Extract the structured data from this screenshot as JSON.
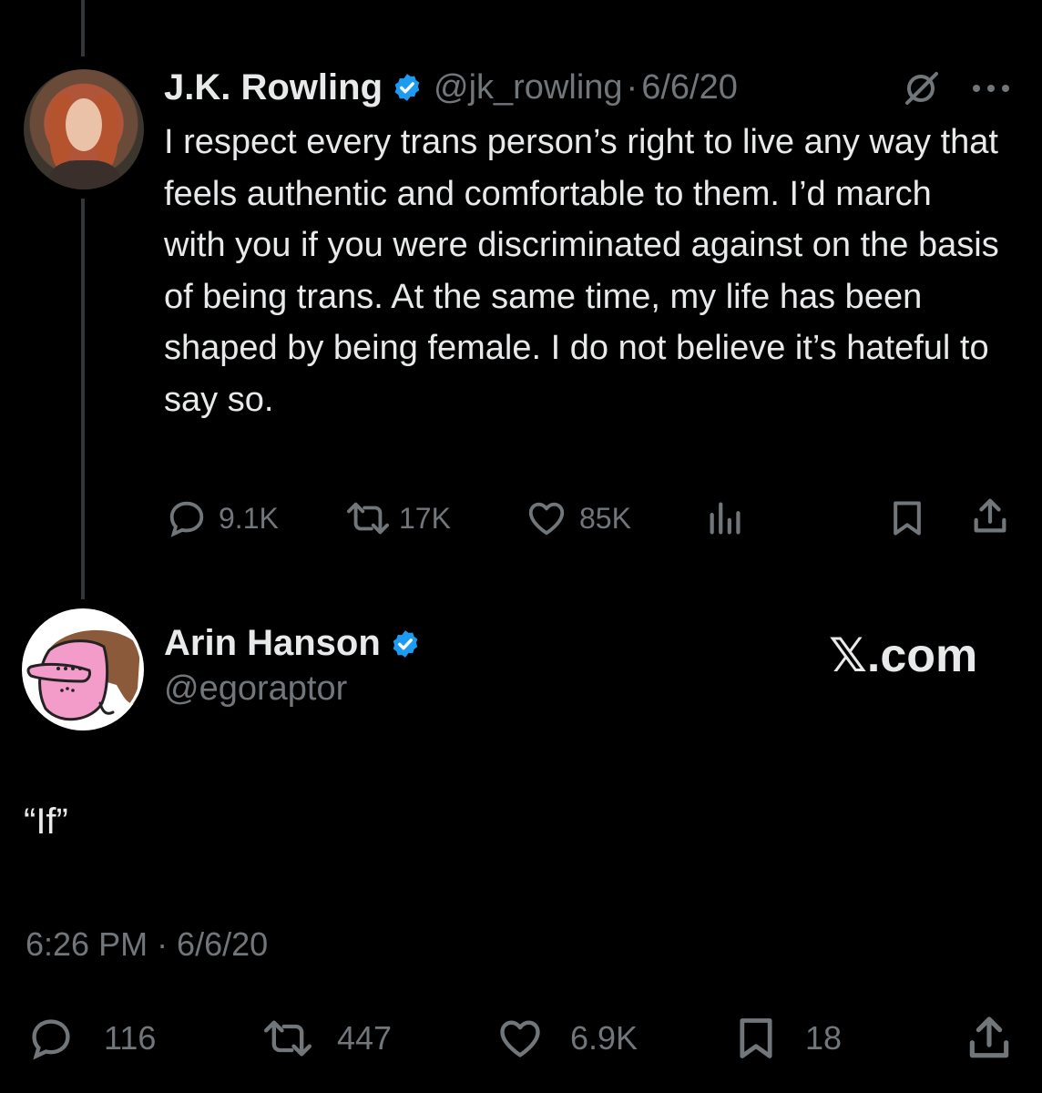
{
  "tweet1": {
    "author_name": "J.K. Rowling",
    "handle": "@jk_rowling",
    "separator": "·",
    "date": "6/6/20",
    "text": "I respect every trans person’s right to live any way that feels authentic and comfortable to them. I’d march with you if you were discriminated against on the basis of being trans. At the same time, my life has been shaped by being female. I do not believe it’s hateful to say so.",
    "stats": {
      "replies": "9.1K",
      "reposts": "17K",
      "likes": "85K"
    }
  },
  "tweet2": {
    "author_name": "Arin Hanson",
    "handle": "@egoraptor",
    "watermark": "𝕏.com",
    "text": "“If”",
    "timestamp": "6:26 PM · 6/6/20",
    "stats": {
      "replies": "116",
      "reposts": "447",
      "likes": "6.9K",
      "bookmarks": "18"
    }
  },
  "colors": {
    "background": "#000000",
    "text": "#e7e9ea",
    "muted": "#71767b",
    "verified": "#1d9bf0"
  },
  "icons": [
    "verified-badge-icon",
    "grok-icon",
    "more-icon",
    "reply-icon",
    "repost-icon",
    "like-icon",
    "views-icon",
    "bookmark-icon",
    "share-icon"
  ]
}
